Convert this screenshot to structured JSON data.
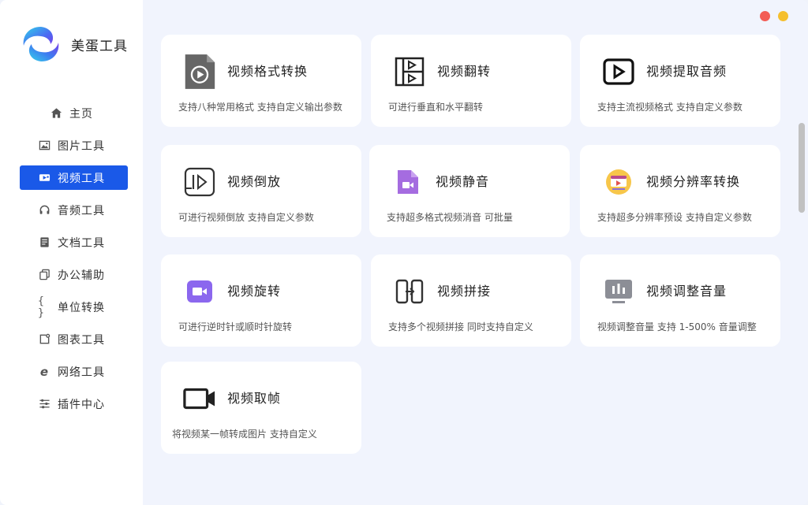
{
  "app": {
    "name": "美蛋工具"
  },
  "nav": [
    {
      "label": "主页",
      "icon": "home-icon"
    },
    {
      "label": "图片工具",
      "icon": "image-icon"
    },
    {
      "label": "视频工具",
      "icon": "video-icon",
      "active": true
    },
    {
      "label": "音频工具",
      "icon": "headphones-icon"
    },
    {
      "label": "文档工具",
      "icon": "document-icon"
    },
    {
      "label": "办公辅助",
      "icon": "copy-icon"
    },
    {
      "label": "单位转换",
      "icon": "braces-icon"
    },
    {
      "label": "图表工具",
      "icon": "chart-icon"
    },
    {
      "label": "网络工具",
      "icon": "browser-icon"
    },
    {
      "label": "插件中心",
      "icon": "sliders-icon"
    }
  ],
  "cards": [
    {
      "title": "视频格式转换",
      "desc": "支持八种常用格式 支持自定义输出参数",
      "icon": "video-file-icon"
    },
    {
      "title": "视频翻转",
      "desc": "可进行垂直和水平翻转",
      "icon": "flip-icon"
    },
    {
      "title": "视频提取音频",
      "desc": "支持主流视频格式 支持自定义参数",
      "icon": "play-box-icon"
    },
    {
      "title": "视频倒放",
      "desc": "可进行视频倒放 支持自定义参数",
      "icon": "reverse-play-icon"
    },
    {
      "title": "视频静音",
      "desc": "支持超多格式视频消音 可批量",
      "icon": "mute-file-icon"
    },
    {
      "title": "视频分辨率转换",
      "desc": "支持超多分辨率预设 支持自定义参数",
      "icon": "resolution-icon"
    },
    {
      "title": "视频旋转",
      "desc": "可进行逆时针或顺时针旋转",
      "icon": "camera-icon"
    },
    {
      "title": "视频拼接",
      "desc": "支持多个视频拼接 同时支持自定义",
      "icon": "merge-icon"
    },
    {
      "title": "视频调整音量",
      "desc": "视频调整音量 支持 1-500% 音量调整",
      "icon": "volume-bars-icon"
    },
    {
      "title": "视频取帧",
      "desc": "将视频某一帧转成图片  支持自定义",
      "icon": "video-camera-icon"
    }
  ],
  "colors": {
    "accent": "#1a59e8",
    "background": "#f1f4fd",
    "close": "#f35c55",
    "minimize": "#f5bf2e"
  }
}
